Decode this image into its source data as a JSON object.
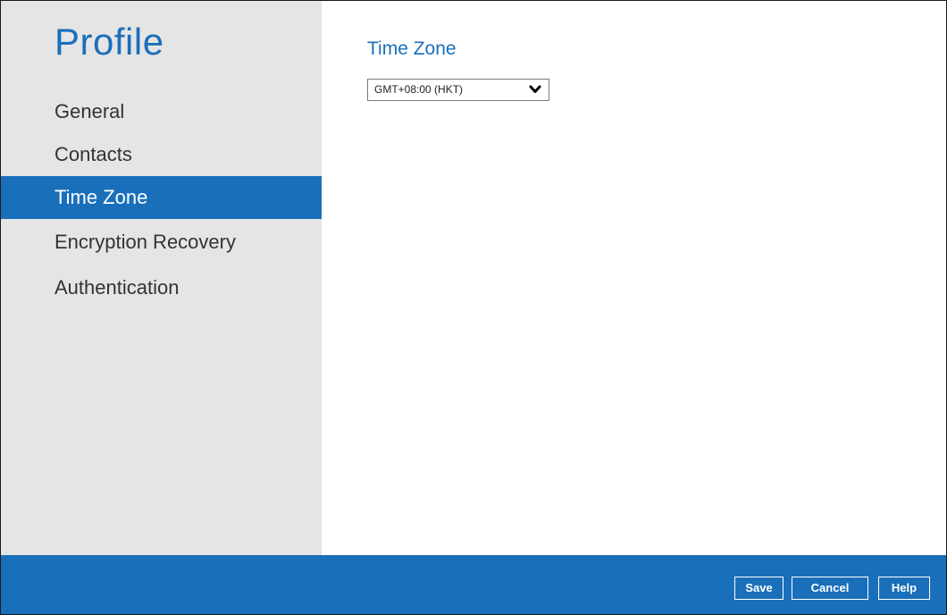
{
  "sidebar": {
    "title": "Profile",
    "items": [
      {
        "label": "General"
      },
      {
        "label": "Contacts"
      },
      {
        "label": "Time Zone",
        "active": true
      },
      {
        "label": "Encryption Recovery"
      },
      {
        "label": "Authentication"
      }
    ]
  },
  "main": {
    "title": "Time Zone",
    "timezone_select": {
      "value": "GMT+08:00 (HKT)",
      "icon": "chevron-down-icon"
    }
  },
  "footer": {
    "save_label": "Save",
    "cancel_label": "Cancel",
    "help_label": "Help"
  },
  "colors": {
    "accent": "#1a6fba",
    "sidebar_bg": "#e5e5e5",
    "nav_text": "#333333"
  }
}
